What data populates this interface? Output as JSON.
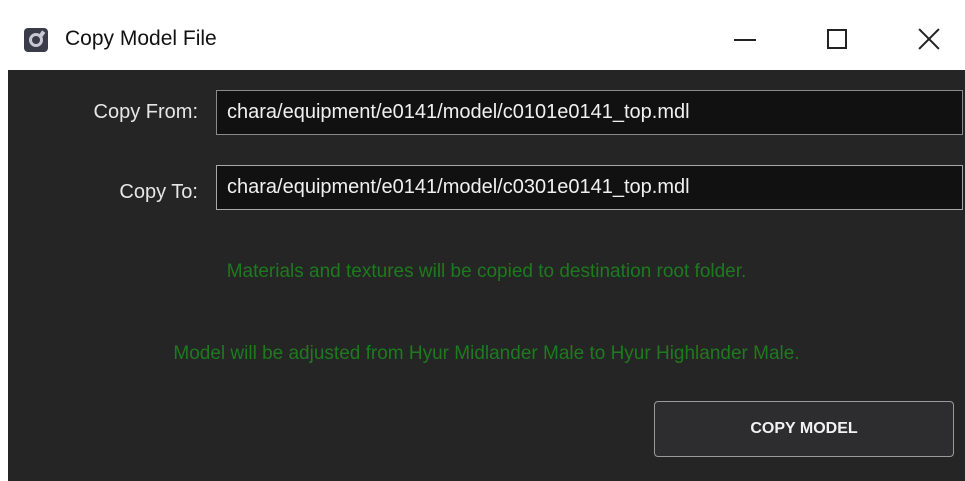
{
  "window": {
    "title": "Copy Model File",
    "app_icon": "app-ring-icon",
    "controls": {
      "minimize": "minimize-icon",
      "maximize": "maximize-icon",
      "close": "close-icon"
    }
  },
  "form": {
    "copy_from_label": "Copy From:",
    "copy_from_value": "chara/equipment/e0141/model/c0101e0141_top.mdl",
    "copy_to_label": "Copy To:",
    "copy_to_value": "chara/equipment/e0141/model/c0301e0141_top.mdl"
  },
  "messages": {
    "materials": "Materials and textures will be copied to destination root folder.",
    "model": "Model will be adjusted from Hyur Midlander Male to Hyur Highlander Male."
  },
  "actions": {
    "copy_label": "COPY MODEL"
  },
  "colors": {
    "background": "#252526",
    "message": "#1d7a1d",
    "input_bg": "#111111"
  }
}
